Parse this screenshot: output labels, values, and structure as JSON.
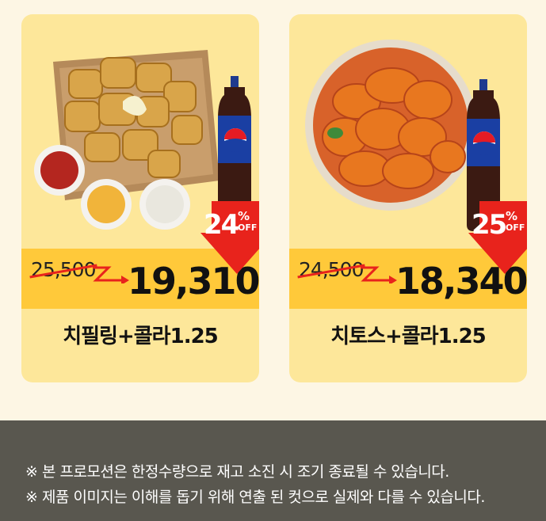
{
  "products": [
    {
      "name": "치필링+콜라1.25",
      "original_price": "25,500",
      "sale_price": "19,310",
      "discount_percent": "24",
      "percent_sign": "%",
      "off_label": "OFF",
      "image": "cheese-filling-chicken-with-sauces-and-pepsi"
    },
    {
      "name": "치토스+콜라1.25",
      "original_price": "24,500",
      "sale_price": "18,340",
      "discount_percent": "25",
      "percent_sign": "%",
      "off_label": "OFF",
      "image": "spicy-cheetos-fried-chicken-and-pepsi"
    }
  ],
  "notices": [
    "※ 본 프로모션은 한정수량으로 재고 소진 시 조기 종료될 수 있습니다.",
    "※ 제품 이미지는 이해를 돕기 위해 연출 된 컷으로 실제와 다를 수 있습니다."
  ],
  "colors": {
    "page_bg": "#fdf6e4",
    "card_bg": "#fde79a",
    "price_band": "#ffc93a",
    "discount_red": "#e8231c",
    "notice_bg": "#59574f"
  },
  "icons": {
    "pepsi_logo": "pepsi-logo-icon",
    "price_arrow": "price-arrow-icon",
    "discount_badge": "discount-arrow-badge"
  }
}
